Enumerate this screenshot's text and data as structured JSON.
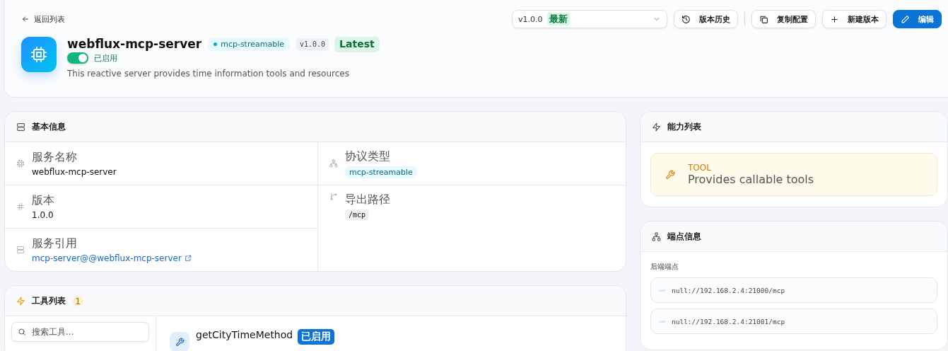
{
  "back_link": "返回列表",
  "version_select": {
    "value": "v1.0.0",
    "tag": "最新"
  },
  "toolbar": [
    {
      "kind": "history",
      "label": "版本历史"
    },
    {
      "kind": "copy",
      "label": "复制配置"
    },
    {
      "kind": "add",
      "label": "新建版本"
    },
    {
      "kind": "edit",
      "label": "编辑"
    }
  ],
  "server": {
    "name": "webflux-mcp-server",
    "protocol": "mcp-streamable",
    "version": "v1.0.0",
    "latest": "Latest",
    "enabled": {
      "on": true,
      "label": "已启用"
    },
    "description": "This reactive server provides time information tools and resources"
  },
  "basic_info": {
    "title": "基本信息",
    "fields": [
      {
        "kind": "name",
        "label": "服务名称",
        "value": "webflux-mcp-server"
      },
      {
        "kind": "protocol",
        "label": "协议类型",
        "value": "mcp-streamable"
      },
      {
        "kind": "version",
        "label": "版本",
        "value": "1.0.0"
      },
      {
        "kind": "path",
        "label": "导出路径",
        "value": "/mcp"
      },
      {
        "kind": "reference",
        "label": "服务引用",
        "value": "mcp-server@@webflux-mcp-server"
      }
    ]
  },
  "tools": {
    "title": "工具列表",
    "count": "1",
    "search": {
      "placeholder": "搜索工具..."
    },
    "items": [
      {
        "name": "getCityTimeMethod",
        "status": "已启用"
      }
    ]
  },
  "capabilities": {
    "title": "能力列表",
    "items": [
      {
        "type": "TOOL",
        "description": "Provides callable tools"
      }
    ]
  },
  "endpoints": {
    "title": "端点信息",
    "group_label": "后端端点",
    "items": [
      "null://192.168.2.4:21000/mcp",
      "null://192.168.2.4:21001/mcp"
    ]
  }
}
